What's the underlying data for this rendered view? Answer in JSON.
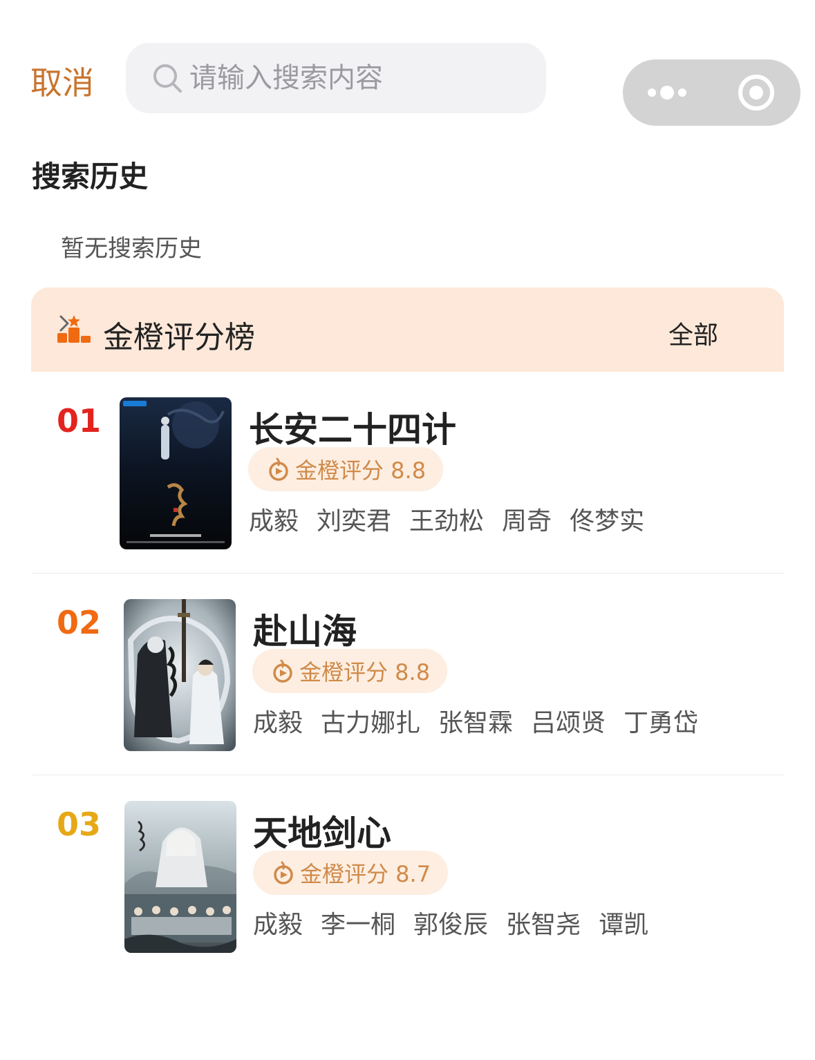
{
  "header": {
    "cancel_label": "取消",
    "search_placeholder": "请输入搜索内容"
  },
  "history": {
    "title": "搜索历史",
    "empty_text": "暂无搜索历史"
  },
  "ranking": {
    "title": "金橙评分榜",
    "all_label": "全部",
    "items": [
      {
        "rank": "01",
        "rank_color": "#e4231f",
        "title": "长安二十四计",
        "rating": "金橙评分 8.8",
        "cast": [
          "成毅",
          "刘奕君",
          "王劲松",
          "周奇",
          "佟梦实"
        ]
      },
      {
        "rank": "02",
        "rank_color": "#f06a12",
        "title": "赴山海",
        "rating": "金橙评分 8.8",
        "cast": [
          "成毅",
          "古力娜扎",
          "张智霖",
          "吕颂贤",
          "丁勇岱"
        ]
      },
      {
        "rank": "03",
        "rank_color": "#e6a817",
        "title": "天地剑心",
        "rating": "金橙评分 8.7",
        "cast": [
          "成毅",
          "李一桐",
          "郭俊辰",
          "张智尧",
          "谭凯"
        ]
      }
    ]
  },
  "colors": {
    "accent": "#c8742d",
    "rating_text": "#d08a4a",
    "rank_header_bg": "#fde8d9"
  }
}
